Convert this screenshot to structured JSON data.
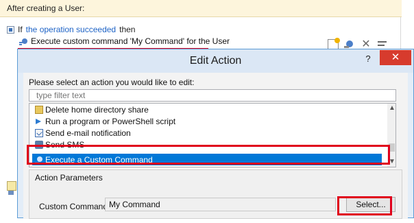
{
  "background_rule": {
    "header": "After creating a User:",
    "if_word": "If",
    "condition_link": "the operation succeeded",
    "then_word": "then",
    "action_text": "Execute custom command 'My Command' for the User",
    "toolbar_icons": [
      "add-condition-icon",
      "add-action-icon",
      "delete-icon",
      "edit-icon"
    ]
  },
  "dialog": {
    "title": "Edit Action",
    "help_label": "?",
    "close_label": "✕",
    "prompt": "Please select an action you would like to edit:",
    "filter_placeholder": "type filter text",
    "actions": [
      {
        "label": "Delete home directory share",
        "icon": "folder-icon"
      },
      {
        "label": "Run a program or PowerShell script",
        "icon": "run-icon"
      },
      {
        "label": "Send e-mail notification",
        "icon": "mail-icon"
      },
      {
        "label": "Send SMS",
        "icon": "sms-icon"
      }
    ],
    "selected_action": {
      "label": "Execute a Custom Command",
      "icon": "gear-icon"
    },
    "params_title": "Action Parameters",
    "custom_command_label": "Custom Command:",
    "custom_command_value": "My Command",
    "select_button": "Select..."
  },
  "colors": {
    "highlight": "#e0001b",
    "selection": "#0078d7",
    "link": "#1e63c6",
    "close_button": "#d73b2d"
  }
}
